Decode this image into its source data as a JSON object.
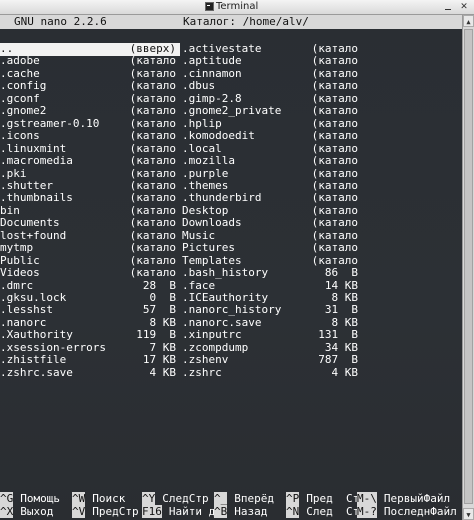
{
  "window": {
    "title": "Terminal"
  },
  "nano": {
    "version": "GNU nano 2.2.6",
    "dir_label": "Каталог: /home/alv/"
  },
  "left_column": [
    {
      "name": "..",
      "size": "(вверх)"
    },
    {
      "name": ".adobe",
      "size": "(катало"
    },
    {
      "name": ".cache",
      "size": "(катало"
    },
    {
      "name": ".config",
      "size": "(катало"
    },
    {
      "name": ".gconf",
      "size": "(катало"
    },
    {
      "name": ".gnome2",
      "size": "(катало"
    },
    {
      "name": ".gstreamer-0.10",
      "size": "(катало"
    },
    {
      "name": ".icons",
      "size": "(катало"
    },
    {
      "name": ".linuxmint",
      "size": "(катало"
    },
    {
      "name": ".macromedia",
      "size": "(катало"
    },
    {
      "name": ".pki",
      "size": "(катало"
    },
    {
      "name": ".shutter",
      "size": "(катало"
    },
    {
      "name": ".thumbnails",
      "size": "(катало"
    },
    {
      "name": "bin",
      "size": "(катало"
    },
    {
      "name": "Documents",
      "size": "(катало"
    },
    {
      "name": "lost+found",
      "size": "(катало"
    },
    {
      "name": "mytmp",
      "size": "(катало"
    },
    {
      "name": "Public",
      "size": "(катало"
    },
    {
      "name": "Videos",
      "size": "(катало"
    },
    {
      "name": ".dmrc",
      "size": "28  B"
    },
    {
      "name": ".gksu.lock",
      "size": "0  B"
    },
    {
      "name": ".lesshst",
      "size": "57  B"
    },
    {
      "name": ".nanorc",
      "size": "8 KB"
    },
    {
      "name": ".Xauthority",
      "size": "119  B"
    },
    {
      "name": ".xsession-errors",
      "size": "7 KB"
    },
    {
      "name": ".zhistfile",
      "size": "17 KB"
    },
    {
      "name": ".zshrc.save",
      "size": "4 KB"
    }
  ],
  "right_column": [
    {
      "name": ".activestate",
      "size": "(катало"
    },
    {
      "name": ".aptitude",
      "size": "(катало"
    },
    {
      "name": ".cinnamon",
      "size": "(катало"
    },
    {
      "name": ".dbus",
      "size": "(катало"
    },
    {
      "name": ".gimp-2.8",
      "size": "(катало"
    },
    {
      "name": ".gnome2_private",
      "size": "(катало"
    },
    {
      "name": ".hplip",
      "size": "(катало"
    },
    {
      "name": ".komodoedit",
      "size": "(катало"
    },
    {
      "name": ".local",
      "size": "(катало"
    },
    {
      "name": ".mozilla",
      "size": "(катало"
    },
    {
      "name": ".purple",
      "size": "(катало"
    },
    {
      "name": ".themes",
      "size": "(катало"
    },
    {
      "name": ".thunderbird",
      "size": "(катало"
    },
    {
      "name": "Desktop",
      "size": "(катало"
    },
    {
      "name": "Downloads",
      "size": "(катало"
    },
    {
      "name": "Music",
      "size": "(катало"
    },
    {
      "name": "Pictures",
      "size": "(катало"
    },
    {
      "name": "Templates",
      "size": "(катало"
    },
    {
      "name": ".bash_history",
      "size": "86  B"
    },
    {
      "name": ".face",
      "size": "14 KB"
    },
    {
      "name": ".ICEauthority",
      "size": "8 KB"
    },
    {
      "name": ".nanorc_history",
      "size": "31  B"
    },
    {
      "name": ".nanorc.save",
      "size": "8 KB"
    },
    {
      "name": ".xinputrc",
      "size": "131  B"
    },
    {
      "name": ".zcompdump",
      "size": "34 KB"
    },
    {
      "name": ".zshenv",
      "size": "787  B"
    },
    {
      "name": ".zshrc",
      "size": "4 KB"
    }
  ],
  "shortcuts": [
    [
      {
        "key": "^G",
        "label": "Помощь"
      },
      {
        "key": "^W",
        "label": "Поиск"
      },
      {
        "key": "^Y",
        "label": "СледСтр"
      },
      {
        "key": "^_",
        "label": "Вперёд"
      },
      {
        "key": "^P",
        "label": "Пред  Стр"
      },
      {
        "key": "M-\\",
        "label": "ПервыйФайл"
      }
    ],
    [
      {
        "key": "^X",
        "label": "Выход"
      },
      {
        "key": "^V",
        "label": "ПредСтр"
      },
      {
        "key": "F16",
        "label": "Найти д"
      },
      {
        "key": "^B",
        "label": "Назад"
      },
      {
        "key": "^N",
        "label": "След  Стр"
      },
      {
        "key": "M-?",
        "label": "ПоследнФайл"
      }
    ]
  ]
}
